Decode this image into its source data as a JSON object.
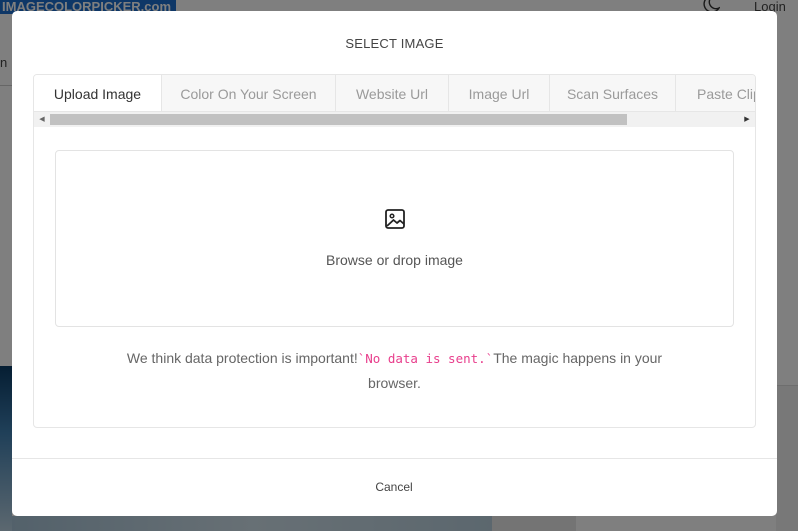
{
  "background": {
    "logo_text": "IMAGECOLORPICKER.com",
    "login_label": "Login",
    "nav_fragment": "n",
    "theme_icon": "moon-icon"
  },
  "modal": {
    "title": "SELECT IMAGE",
    "tabs": [
      {
        "label": "Upload Image",
        "active": true
      },
      {
        "label": "Color On Your Screen",
        "active": false
      },
      {
        "label": "Website Url",
        "active": false
      },
      {
        "label": "Image Url",
        "active": false
      },
      {
        "label": "Scan Surfaces",
        "active": false
      },
      {
        "label": "Paste Clipboard",
        "active": false
      }
    ],
    "dropzone": {
      "icon": "image-icon",
      "label": "Browse or drop image"
    },
    "note": {
      "before": "We think data protection is important!",
      "code": "`No data is sent.`",
      "after": "The magic happens in your browser."
    },
    "cancel_label": "Cancel"
  },
  "colors": {
    "overlay": "rgba(0,0,0,0.5)",
    "accent_code": "#e83e8c",
    "brand_blue": "#1d6fcf"
  }
}
